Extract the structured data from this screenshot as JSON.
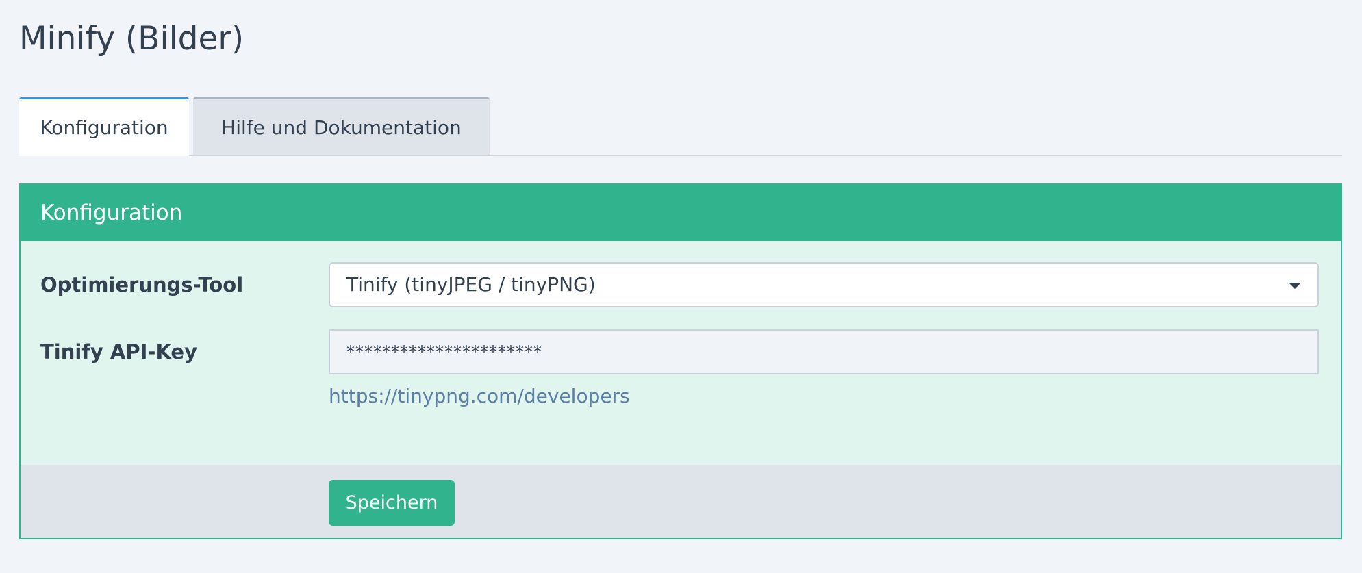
{
  "page": {
    "title": "Minify (Bilder)"
  },
  "tabs": [
    {
      "label": "Konfiguration",
      "active": true
    },
    {
      "label": "Hilfe und Dokumentation",
      "active": false
    }
  ],
  "panel": {
    "heading": "Konfiguration",
    "fields": {
      "tool": {
        "label": "Optimierungs-Tool",
        "selected": "Tinify (tinyJPEG / tinyPNG)"
      },
      "api_key": {
        "label": "Tinify API-Key",
        "value": "**********************",
        "help_link": "https://tinypng.com/developers"
      }
    },
    "save_label": "Speichern"
  },
  "colors": {
    "accent": "#31b38e",
    "tab_active_border": "#3c8fd8",
    "link": "#5c7ea6",
    "panel_body": "#dff5ed"
  }
}
